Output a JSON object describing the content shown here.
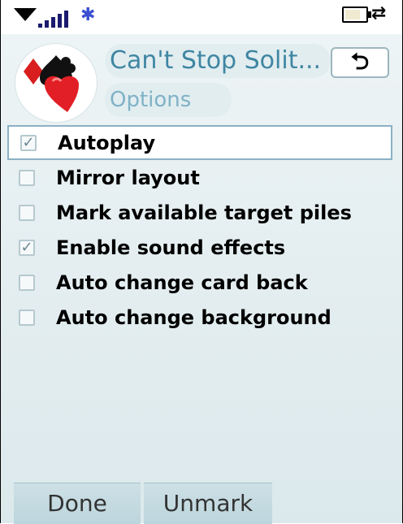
{
  "statusbar": {
    "icons": [
      "network-triangle-icon",
      "signal-bars-icon",
      "bluetooth-icon",
      "battery-icon",
      "sync-icon"
    ],
    "signal_strength": 5
  },
  "header": {
    "app_title": "Can't Stop Solit...",
    "subtitle": "Options",
    "back_icon": "back-arrow-icon",
    "app_icon": "card-suits-icon"
  },
  "options": [
    {
      "label": "Autoplay",
      "checked": true,
      "selected": true
    },
    {
      "label": "Mirror layout",
      "checked": false,
      "selected": false
    },
    {
      "label": "Mark available target piles",
      "checked": false,
      "selected": false
    },
    {
      "label": "Enable sound effects",
      "checked": true,
      "selected": false
    },
    {
      "label": "Auto change card back",
      "checked": false,
      "selected": false
    },
    {
      "label": "Auto change background",
      "checked": false,
      "selected": false
    }
  ],
  "softkeys": {
    "left": "Done",
    "right": "Unmark"
  },
  "colors": {
    "title": "#3f86a2",
    "subtitle": "#7fb2c6",
    "selection_border": "#8bb1c4",
    "softkey_bg": "#c7dce2",
    "icon_red": "#d81e1e"
  }
}
